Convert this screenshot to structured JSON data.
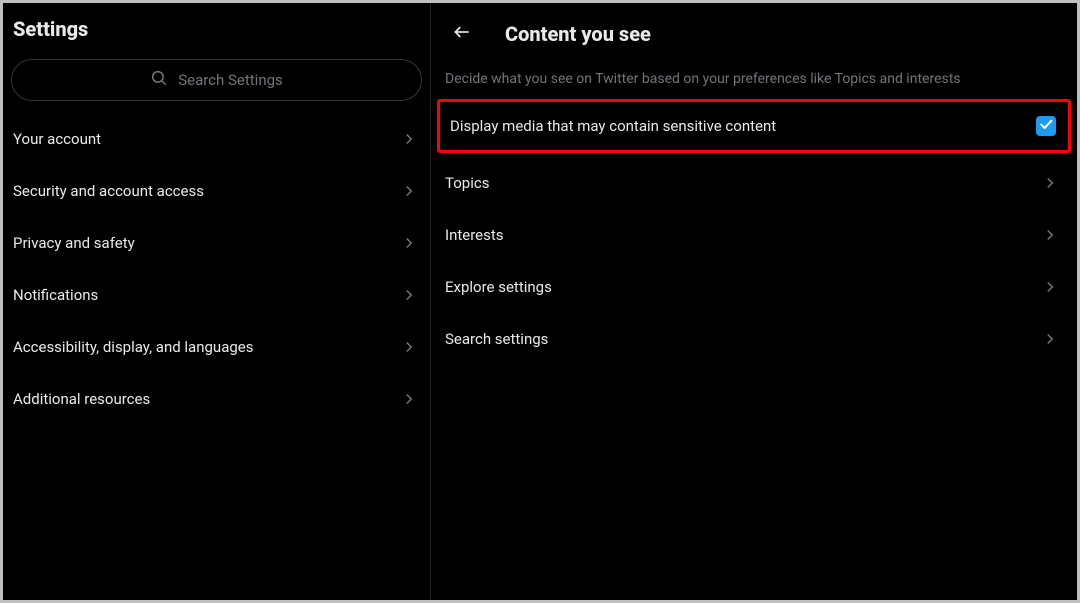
{
  "sidebar": {
    "title": "Settings",
    "search_placeholder": "Search Settings",
    "items": [
      {
        "label": "Your account"
      },
      {
        "label": "Security and account access"
      },
      {
        "label": "Privacy and safety"
      },
      {
        "label": "Notifications"
      },
      {
        "label": "Accessibility, display, and languages"
      },
      {
        "label": "Additional resources"
      }
    ]
  },
  "main": {
    "title": "Content you see",
    "subtitle": "Decide what you see on Twitter based on your preferences like Topics and interests",
    "sensitive_row": {
      "label": "Display media that may contain sensitive content",
      "checked": true
    },
    "items": [
      {
        "label": "Topics"
      },
      {
        "label": "Interests"
      },
      {
        "label": "Explore settings"
      },
      {
        "label": "Search settings"
      }
    ]
  },
  "colors": {
    "accent": "#1d9bf0",
    "highlight": "#ff0000",
    "text_muted": "#71767b"
  }
}
